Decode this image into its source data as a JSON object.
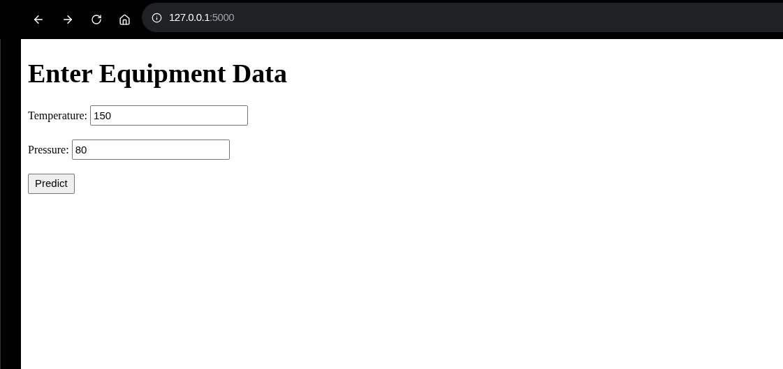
{
  "browser": {
    "url_host": "127.0.0.1",
    "url_port": ":5000"
  },
  "page": {
    "heading": "Enter Equipment Data",
    "fields": [
      {
        "label": "Temperature:",
        "value": "150"
      },
      {
        "label": "Pressure:",
        "value": "80"
      }
    ],
    "button": "Predict"
  }
}
